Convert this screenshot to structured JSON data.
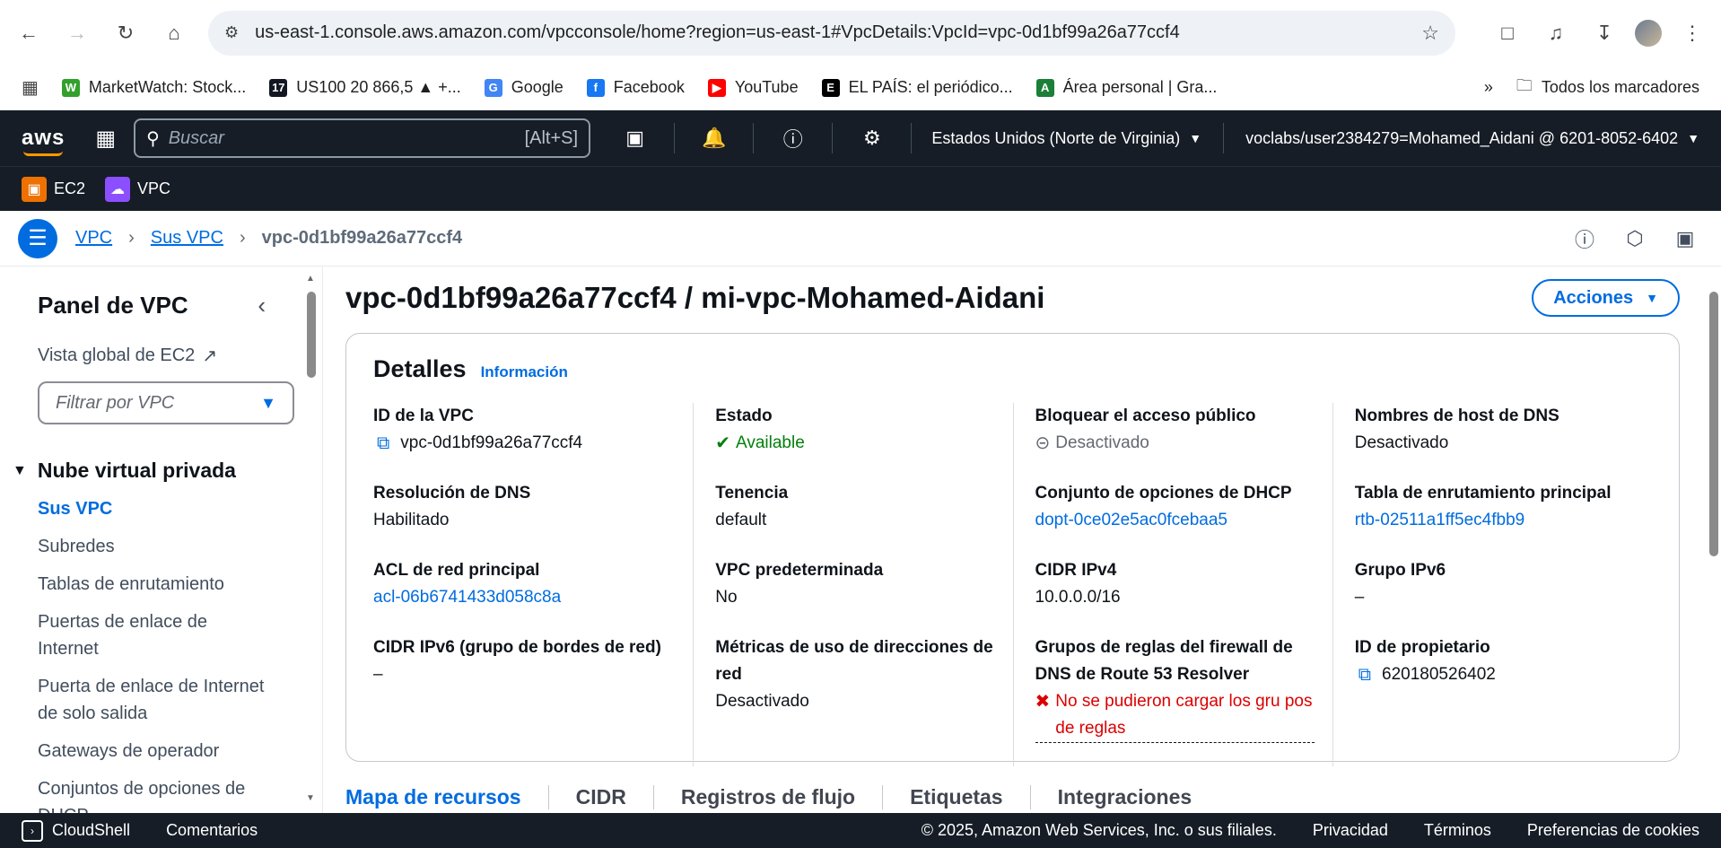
{
  "browser": {
    "url": "us-east-1.console.aws.amazon.com/vpcconsole/home?region=us-east-1#VpcDetails:VpcId=vpc-0d1bf99a26a77ccf4",
    "bookmarks": [
      {
        "label": "MarketWatch: Stock...",
        "icon": "W",
        "color": "#33a02c"
      },
      {
        "label": "US100 20 866,5 ▲ +...",
        "icon": "17",
        "color": "#131722"
      },
      {
        "label": "Google",
        "icon": "G",
        "color": "#4285f4"
      },
      {
        "label": "Facebook",
        "icon": "f",
        "color": "#1877f2"
      },
      {
        "label": "YouTube",
        "icon": "▶",
        "color": "#ff0000"
      },
      {
        "label": "EL PAÍS: el periódico...",
        "icon": "E",
        "color": "#000000"
      },
      {
        "label": "Área personal | Gra...",
        "icon": "A",
        "color": "#1a7f37"
      }
    ],
    "all_bookmarks": "Todos los marcadores"
  },
  "aws": {
    "search_placeholder": "Buscar",
    "search_shortcut": "[Alt+S]",
    "region": "Estados Unidos (Norte de Virginia)",
    "user": "voclabs/user2384279=Mohamed_Aidani @ 6201-8052-6402",
    "services": [
      {
        "label": "EC2",
        "color": "#ed7100"
      },
      {
        "label": "VPC",
        "color": "#8c4fff"
      }
    ]
  },
  "breadcrumb": {
    "items": [
      "VPC",
      "Sus VPC"
    ],
    "current": "vpc-0d1bf99a26a77ccf4"
  },
  "sidebar": {
    "title": "Panel de VPC",
    "ec2_global": "Vista global de EC2",
    "filter_placeholder": "Filtrar por VPC",
    "section": "Nube virtual privada",
    "items": [
      {
        "label": "Sus VPC",
        "active": true
      },
      {
        "label": "Subredes"
      },
      {
        "label": "Tablas de enrutamiento"
      },
      {
        "label": "Puertas de enlace de Internet"
      },
      {
        "label": "Puerta de enlace de Internet de solo salida"
      },
      {
        "label": "Gateways de operador"
      },
      {
        "label": "Conjuntos de opciones de DHCP"
      }
    ]
  },
  "page": {
    "title": "vpc-0d1bf99a26a77ccf4 / mi-vpc-Mohamed-Aidani",
    "actions": "Acciones",
    "details_title": "Detalles",
    "info_link": "Información",
    "columns": [
      [
        {
          "label": "ID de la VPC",
          "value": "vpc-0d1bf99a26a77ccf4",
          "kind": "copy"
        },
        {
          "label": "Resolución de DNS",
          "value": "Habilitado"
        },
        {
          "label": "ACL de red principal",
          "value": "acl-06b6741433d058c8a",
          "kind": "link"
        },
        {
          "label": "CIDR IPv6 (grupo de bordes de red)",
          "value": "–"
        }
      ],
      [
        {
          "label": "Estado",
          "value": "Available",
          "kind": "ok"
        },
        {
          "label": "Tenencia",
          "value": "default"
        },
        {
          "label": "VPC predeterminada",
          "value": "No"
        },
        {
          "label": "Métricas de uso de direcciones de red",
          "value": "Desactivado"
        }
      ],
      [
        {
          "label": "Bloquear el acceso público",
          "value": "Desactivado",
          "kind": "muted"
        },
        {
          "label": "Conjunto de opciones de DHCP",
          "value": "dopt-0ce02e5ac0fcebaa5",
          "kind": "link"
        },
        {
          "label": "CIDR IPv4",
          "value": "10.0.0.0/16"
        },
        {
          "label": "Grupos de reglas del firewall de DNS de Route 53 Resolver",
          "value": "No se pudieron cargar los gru pos de reglas",
          "kind": "err"
        }
      ],
      [
        {
          "label": "Nombres de host de DNS",
          "value": "Desactivado"
        },
        {
          "label": "Tabla de enrutamiento principal",
          "value": "rtb-02511a1ff5ec4fbb9",
          "kind": "link"
        },
        {
          "label": "Grupo IPv6",
          "value": "–"
        },
        {
          "label": "ID de propietario",
          "value": "620180526402",
          "kind": "copy"
        }
      ]
    ],
    "tabs": [
      "Mapa de recursos",
      "CIDR",
      "Registros de flujo",
      "Etiquetas",
      "Integraciones"
    ]
  },
  "footer": {
    "cloudshell": "CloudShell",
    "feedback": "Comentarios",
    "copyright": "© 2025, Amazon Web Services, Inc. o sus filiales.",
    "privacy": "Privacidad",
    "terms": "Términos",
    "cookies": "Preferencias de cookies"
  }
}
